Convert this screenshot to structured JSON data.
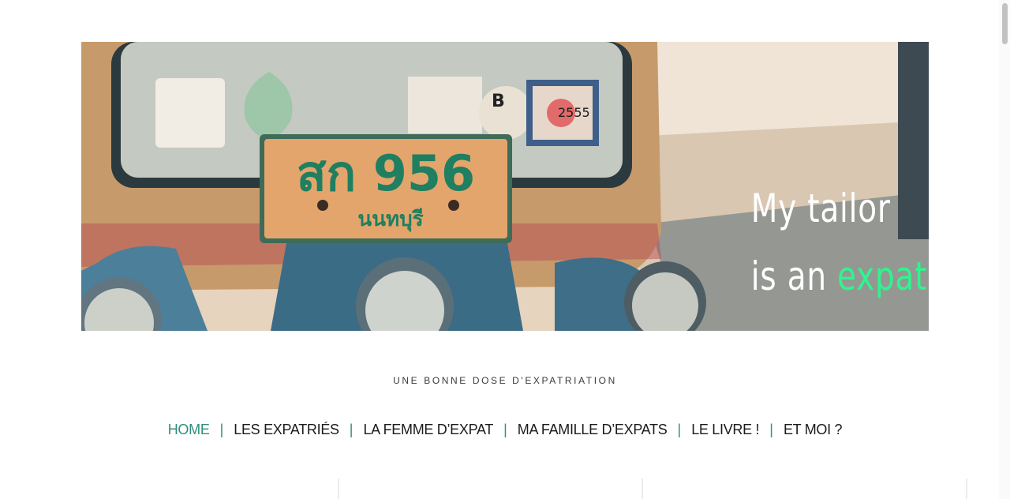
{
  "site": {
    "banner": {
      "title_line1": "My tailor",
      "title_line2_prefix": "is an",
      "title_line2_accent": "expat",
      "plate_text": "สก 956",
      "plate_province": "นนทบุรี",
      "sticker_number": "2555",
      "sticker_letter": "B"
    },
    "tagline": "UNE BONNE DOSE D'EXPATRIATION",
    "nav": [
      {
        "label": "HOME",
        "active": true
      },
      {
        "label": "LES EXPATRIÉS",
        "active": false
      },
      {
        "label": "LA FEMME D’EXPAT",
        "active": false
      },
      {
        "label": "MA FAMILLE D’EXPATS",
        "active": false
      },
      {
        "label": "LE LIVRE !",
        "active": false
      },
      {
        "label": "ET MOI ?",
        "active": false
      }
    ],
    "nav_separator": "|"
  },
  "colors": {
    "accent": "#2f8f7c",
    "banner_accent": "#2ef58f"
  }
}
